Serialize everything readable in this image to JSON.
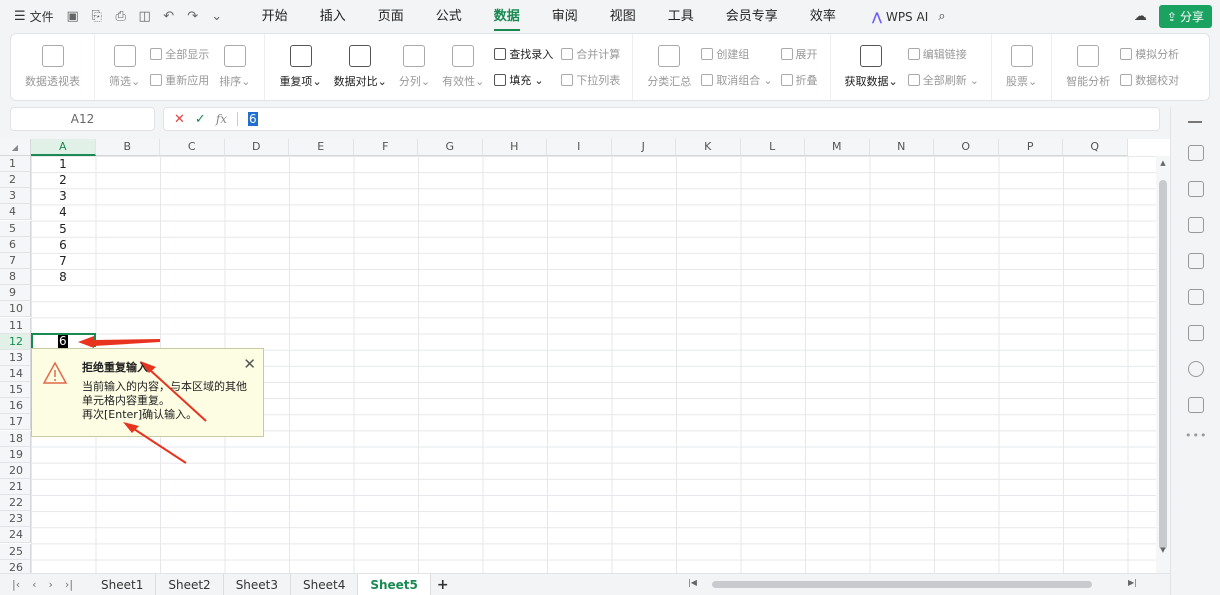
{
  "menubar": {
    "file_label": "文件",
    "tabs": [
      "开始",
      "插入",
      "页面",
      "公式",
      "数据",
      "审阅",
      "视图",
      "工具",
      "会员专享",
      "效率"
    ],
    "active_tab": "数据",
    "wps_ai": "WPS AI",
    "share": "分享"
  },
  "ribbon": {
    "pivot": "数据透视表",
    "filter": "筛选",
    "show_all": "全部显示",
    "reapply": "重新应用",
    "sort": "排序",
    "duplicates": "重复项",
    "compare": "数据对比",
    "split": "分列",
    "validity": "有效性",
    "lookup_entry": "查找录入",
    "fill": "填充",
    "consolidate": "合并计算",
    "dropdown_list": "下拉列表",
    "subtotal": "分类汇总",
    "group": "创建组",
    "ungroup": "取消组合",
    "expand": "展开",
    "collapse": "折叠",
    "get_data": "获取数据",
    "edit_links": "编辑链接",
    "refresh_all": "全部刷新",
    "stocks": "股票",
    "smart_analysis": "智能分析",
    "what_if": "模拟分析",
    "data_check": "数据校对"
  },
  "formula_bar": {
    "cell_ref": "A12",
    "fx": "fx",
    "value": "6"
  },
  "grid": {
    "columns": [
      "A",
      "B",
      "C",
      "D",
      "E",
      "F",
      "G",
      "H",
      "I",
      "J",
      "K",
      "L",
      "M",
      "N",
      "O",
      "P",
      "Q"
    ],
    "rows": [
      "1",
      "2",
      "3",
      "4",
      "5",
      "6",
      "7",
      "8",
      "9",
      "10",
      "11",
      "12",
      "13",
      "14",
      "15",
      "16",
      "17",
      "18",
      "19",
      "20",
      "21",
      "22",
      "23",
      "24",
      "25",
      "26"
    ],
    "values_col_a": [
      "1",
      "2",
      "3",
      "4",
      "5",
      "6",
      "7",
      "8"
    ],
    "editing_value": "6"
  },
  "tooltip": {
    "title": "拒绝重复输入",
    "line1": "当前输入的内容，与本区域的其他",
    "line2": "单元格内容重复。",
    "line3": "再次[Enter]确认输入。"
  },
  "sheets": {
    "tabs": [
      "Sheet1",
      "Sheet2",
      "Sheet3",
      "Sheet4",
      "Sheet5"
    ],
    "active": "Sheet5",
    "add": "+"
  },
  "colors": {
    "accent": "#1a8a52",
    "share_bg": "#1aa260",
    "arrow": "#e8331f",
    "tooltip_bg": "#fdfde4"
  }
}
